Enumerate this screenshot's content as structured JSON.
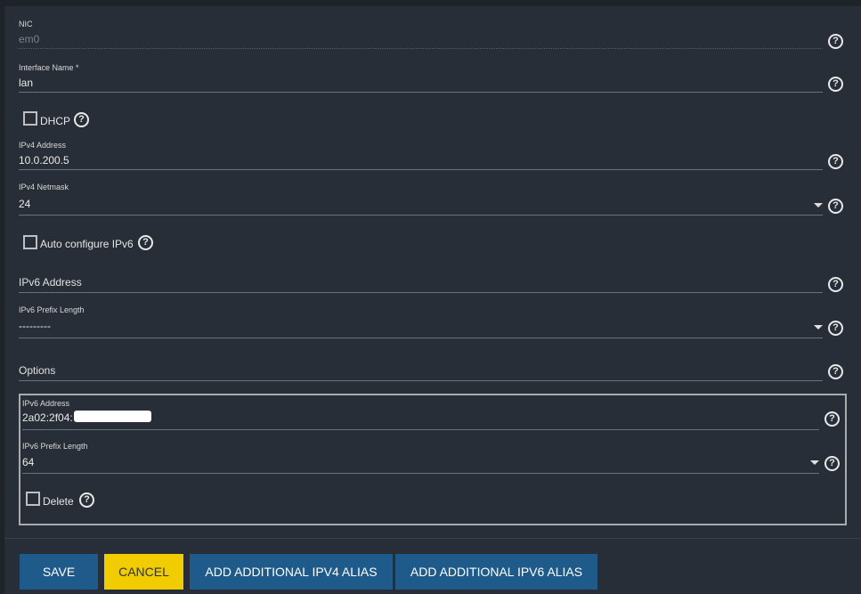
{
  "nic": {
    "label": "NIC",
    "value": "em0"
  },
  "interface_name": {
    "label": "Interface Name *",
    "value": "lan"
  },
  "dhcp": {
    "label": "DHCP",
    "checked": false
  },
  "ipv4_address": {
    "label": "IPv4 Address",
    "value": "10.0.200.5"
  },
  "ipv4_netmask": {
    "label": "IPv4 Netmask",
    "value": "24"
  },
  "auto_ipv6": {
    "label": "Auto configure IPv6",
    "checked": false
  },
  "ipv6_address": {
    "placeholder": "IPv6 Address"
  },
  "ipv6_prefix": {
    "label": "IPv6 Prefix Length",
    "value": "---------"
  },
  "options": {
    "placeholder": "Options"
  },
  "alias": {
    "ipv6_label": "IPv6 Address",
    "ipv6_value": "2a02:2f04:",
    "prefix_label": "IPv6 Prefix Length",
    "prefix_value": "64",
    "delete_label": "Delete",
    "delete_checked": false
  },
  "help_glyph": "?",
  "buttons": {
    "save": "SAVE",
    "cancel": "CANCEL",
    "add_ipv4": "ADD ADDITIONAL IPV4 ALIAS",
    "add_ipv6": "ADD ADDITIONAL IPV6 ALIAS"
  },
  "colors": {
    "primary": "#1e5a8a",
    "warning": "#f0cc00",
    "panel": "#282e37"
  }
}
